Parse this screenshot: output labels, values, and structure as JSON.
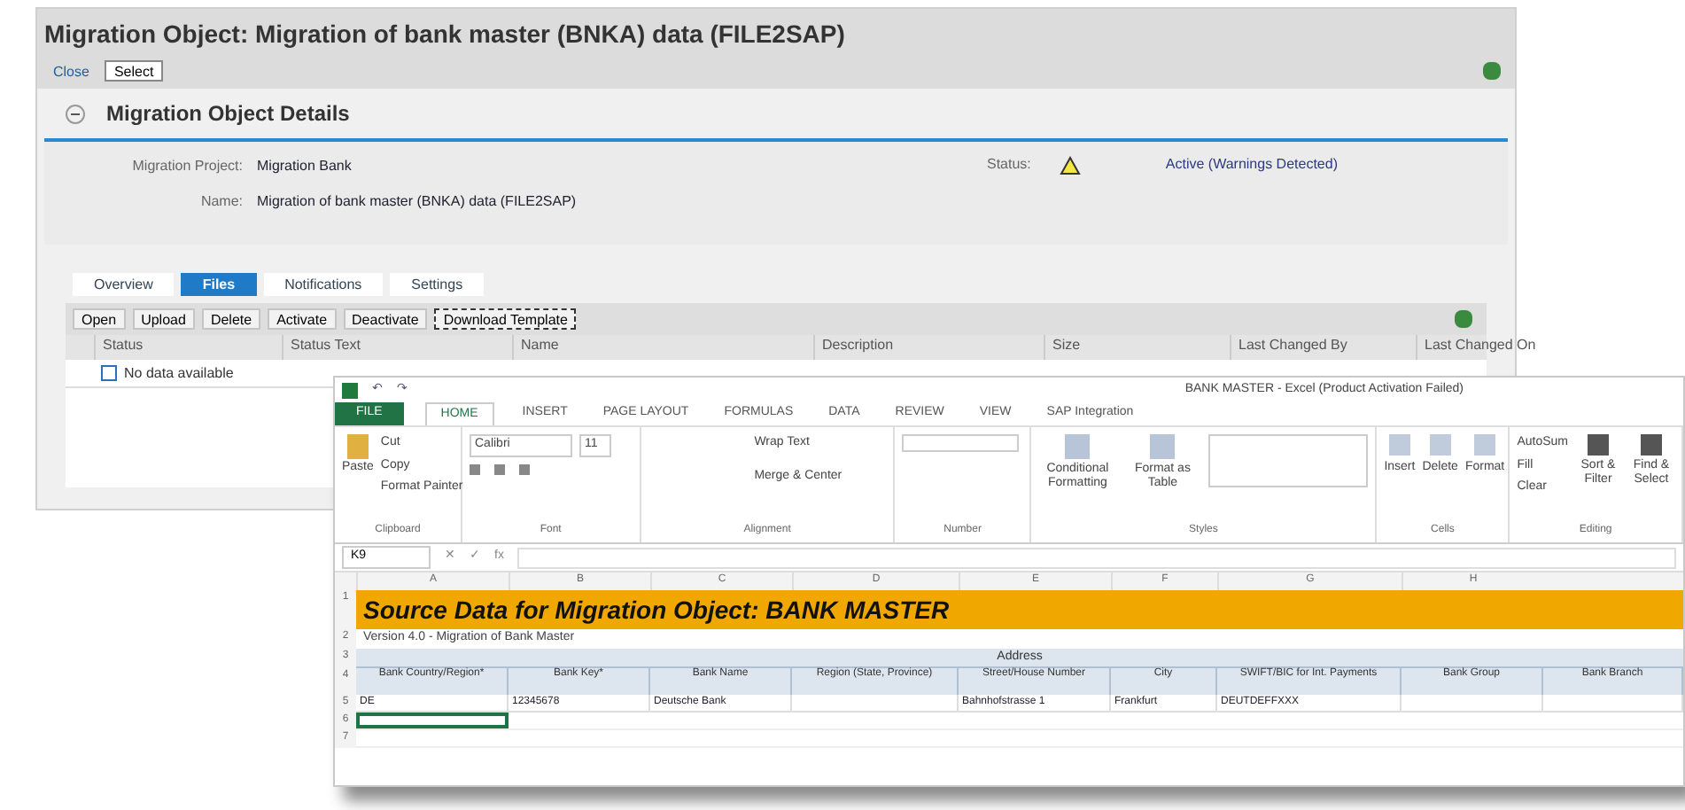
{
  "window": {
    "title": "Migration Object: Migration of bank master (BNKA) data (FILE2SAP)"
  },
  "toolbar": {
    "buttons": [
      {
        "label": "Close",
        "selected": false
      },
      {
        "label": "Select",
        "selected": true
      }
    ]
  },
  "section": {
    "title": "Migration Object Details",
    "expanded": true
  },
  "details": {
    "fields": [
      {
        "label": "Migration Project:",
        "value": "Migration Bank"
      },
      {
        "label": "Name:",
        "value": "Migration of bank master (BNKA) data (FILE2SAP)"
      }
    ],
    "status": {
      "label": "Status:",
      "value": "Active (Warnings Detected)"
    }
  },
  "tabs": [
    {
      "label": "Overview",
      "selected": false
    },
    {
      "label": "Files",
      "selected": true
    },
    {
      "label": "Notifications",
      "selected": false
    },
    {
      "label": "Settings",
      "selected": false
    }
  ],
  "file_buttons": [
    {
      "label": "Open",
      "focused": false
    },
    {
      "label": "Upload",
      "focused": false
    },
    {
      "label": "Delete",
      "focused": false
    },
    {
      "label": "Activate",
      "focused": false
    },
    {
      "label": "Deactivate",
      "focused": false
    },
    {
      "label": "Download Template",
      "focused": true
    }
  ],
  "table": {
    "columns": [
      "Status",
      "Status Text",
      "Name",
      "Description",
      "Size",
      "Last Changed By",
      "Last Changed On"
    ],
    "empty_text": "No data available"
  },
  "excel": {
    "title": "BANK MASTER - Excel (Product Activation Failed)",
    "quick_access": [
      "↶",
      "↷"
    ],
    "ribbon_tabs": [
      {
        "label": "FILE",
        "selected": false
      },
      {
        "label": "HOME",
        "selected": true
      },
      {
        "label": "INSERT",
        "selected": false
      },
      {
        "label": "PAGE LAYOUT",
        "selected": false
      },
      {
        "label": "FORMULAS",
        "selected": false
      },
      {
        "label": "DATA",
        "selected": false
      },
      {
        "label": "REVIEW",
        "selected": false
      },
      {
        "label": "VIEW",
        "selected": false
      },
      {
        "label": "SAP Integration",
        "selected": false
      }
    ],
    "clipboard": {
      "paste": "Paste",
      "items": [
        "Cut",
        "Copy",
        "Format Painter"
      ],
      "group": "Clipboard"
    },
    "font": {
      "name": "Calibri",
      "size": "11",
      "group": "Font"
    },
    "alignment": {
      "items": [
        "Wrap Text",
        "Merge & Center"
      ],
      "group": "Alignment"
    },
    "number": {
      "group": "Number"
    },
    "styles": {
      "items": [
        "Conditional Formatting",
        "Format as Table"
      ],
      "group": "Styles"
    },
    "cells": {
      "items": [
        "Insert",
        "Delete",
        "Format"
      ],
      "group": "Cells"
    },
    "editing": {
      "items": [
        "AutoSum",
        "Fill",
        "Clear"
      ],
      "big": [
        "Sort & Filter",
        "Find & Select"
      ],
      "group": "Editing"
    },
    "name_box": "K9",
    "formula_marks": [
      "✕",
      "✓",
      "fx"
    ],
    "column_letters": [
      "A",
      "B",
      "C",
      "D",
      "E",
      "F",
      "G",
      "H"
    ],
    "sheet_title": "Source Data for Migration Object:  BANK  MASTER",
    "sheet_subtitle": "Version 4.0 - Migration of Bank Master",
    "group_header": "Address",
    "headers": [
      "Bank Country/Region*",
      "Bank Key*",
      "Bank Name",
      "Region (State, Province)",
      "Street/House Number",
      "City",
      "SWIFT/BIC for Int. Payments",
      "Bank Group",
      "Bank Branch"
    ],
    "rows": [
      [
        "DE",
        "12345678",
        "Deutsche Bank",
        "",
        "Bahnhofstrasse 1",
        "Frankfurt",
        "DEUTDEFFXXX",
        "",
        ""
      ]
    ],
    "row_numbers": [
      "1",
      "2",
      "3",
      "4",
      "5",
      "6",
      "7"
    ]
  }
}
